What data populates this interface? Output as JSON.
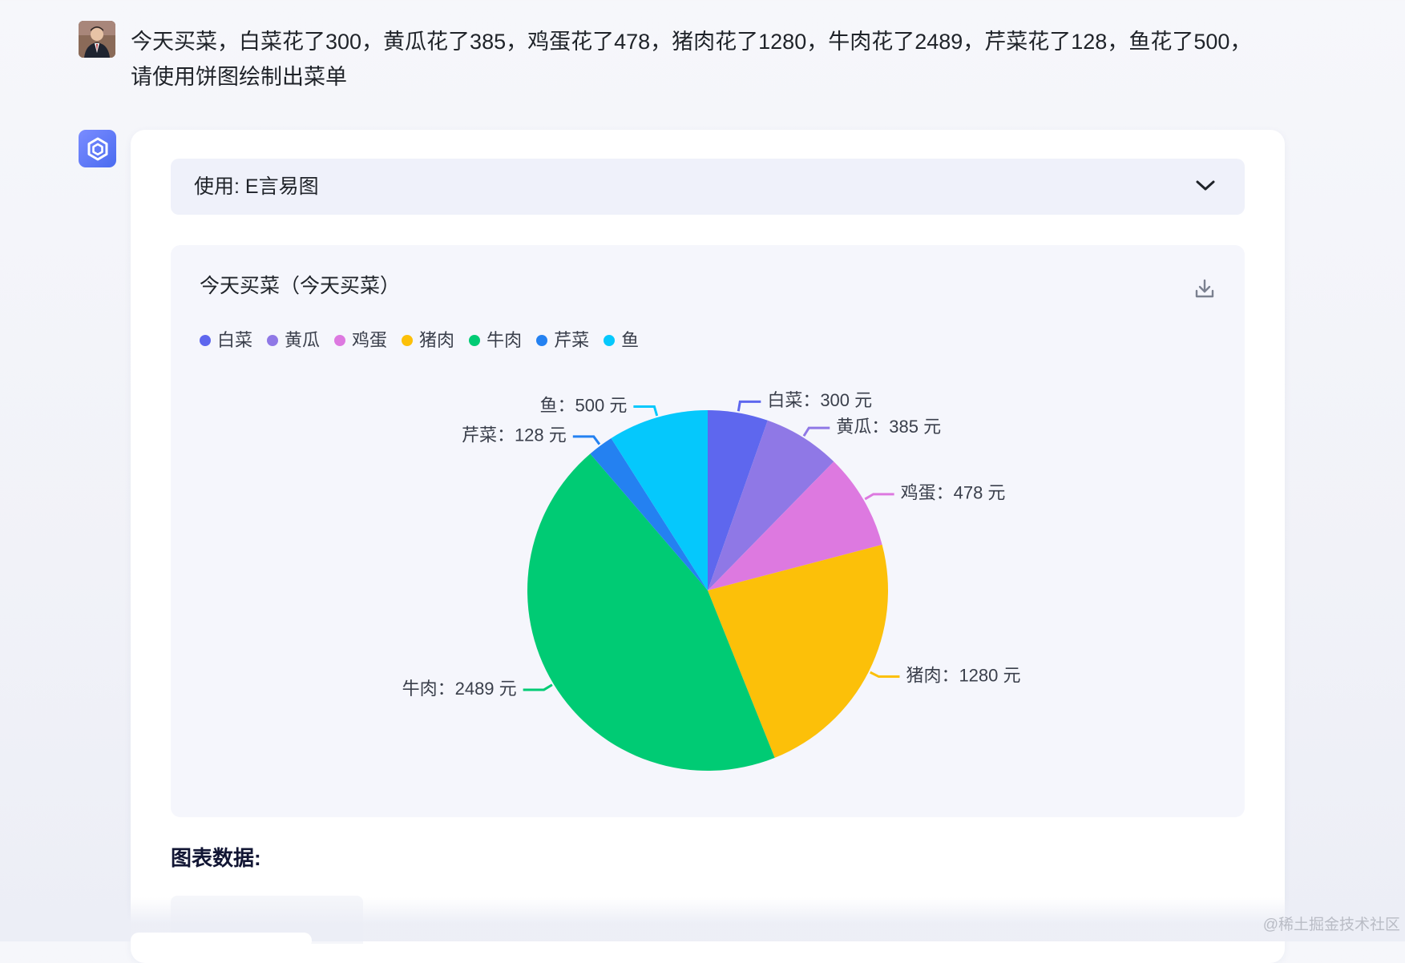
{
  "user_message": {
    "text": "今天买菜，白菜花了300，黄瓜花了385，鸡蛋花了478，猪肉花了1280，牛肉花了2489，芹菜花了128，鱼花了500，请使用饼图绘制出菜单"
  },
  "bot": {
    "plugin_label": "使用: E言易图",
    "data_heading": "图表数据:"
  },
  "watermark": "@稀土掘金技术社区",
  "chart_data": {
    "type": "pie",
    "title": "今天买菜（今天买菜）",
    "unit": "元",
    "legend_position": "top-left",
    "categories": [
      "白菜",
      "黄瓜",
      "鸡蛋",
      "猪肉",
      "牛肉",
      "芹菜",
      "鱼"
    ],
    "values": [
      300,
      385,
      478,
      1280,
      2489,
      128,
      500
    ],
    "colors": [
      "#5e67ee",
      "#8f78e6",
      "#dd79e0",
      "#fcc009",
      "#00cb74",
      "#2481f1",
      "#05c8fc"
    ],
    "slice_labels": [
      "白菜：300 元",
      "黄瓜：385 元",
      "鸡蛋：478 元",
      "猪肉：1280 元",
      "牛肉：2489 元",
      "芹菜：128 元",
      "鱼：500 元"
    ]
  }
}
